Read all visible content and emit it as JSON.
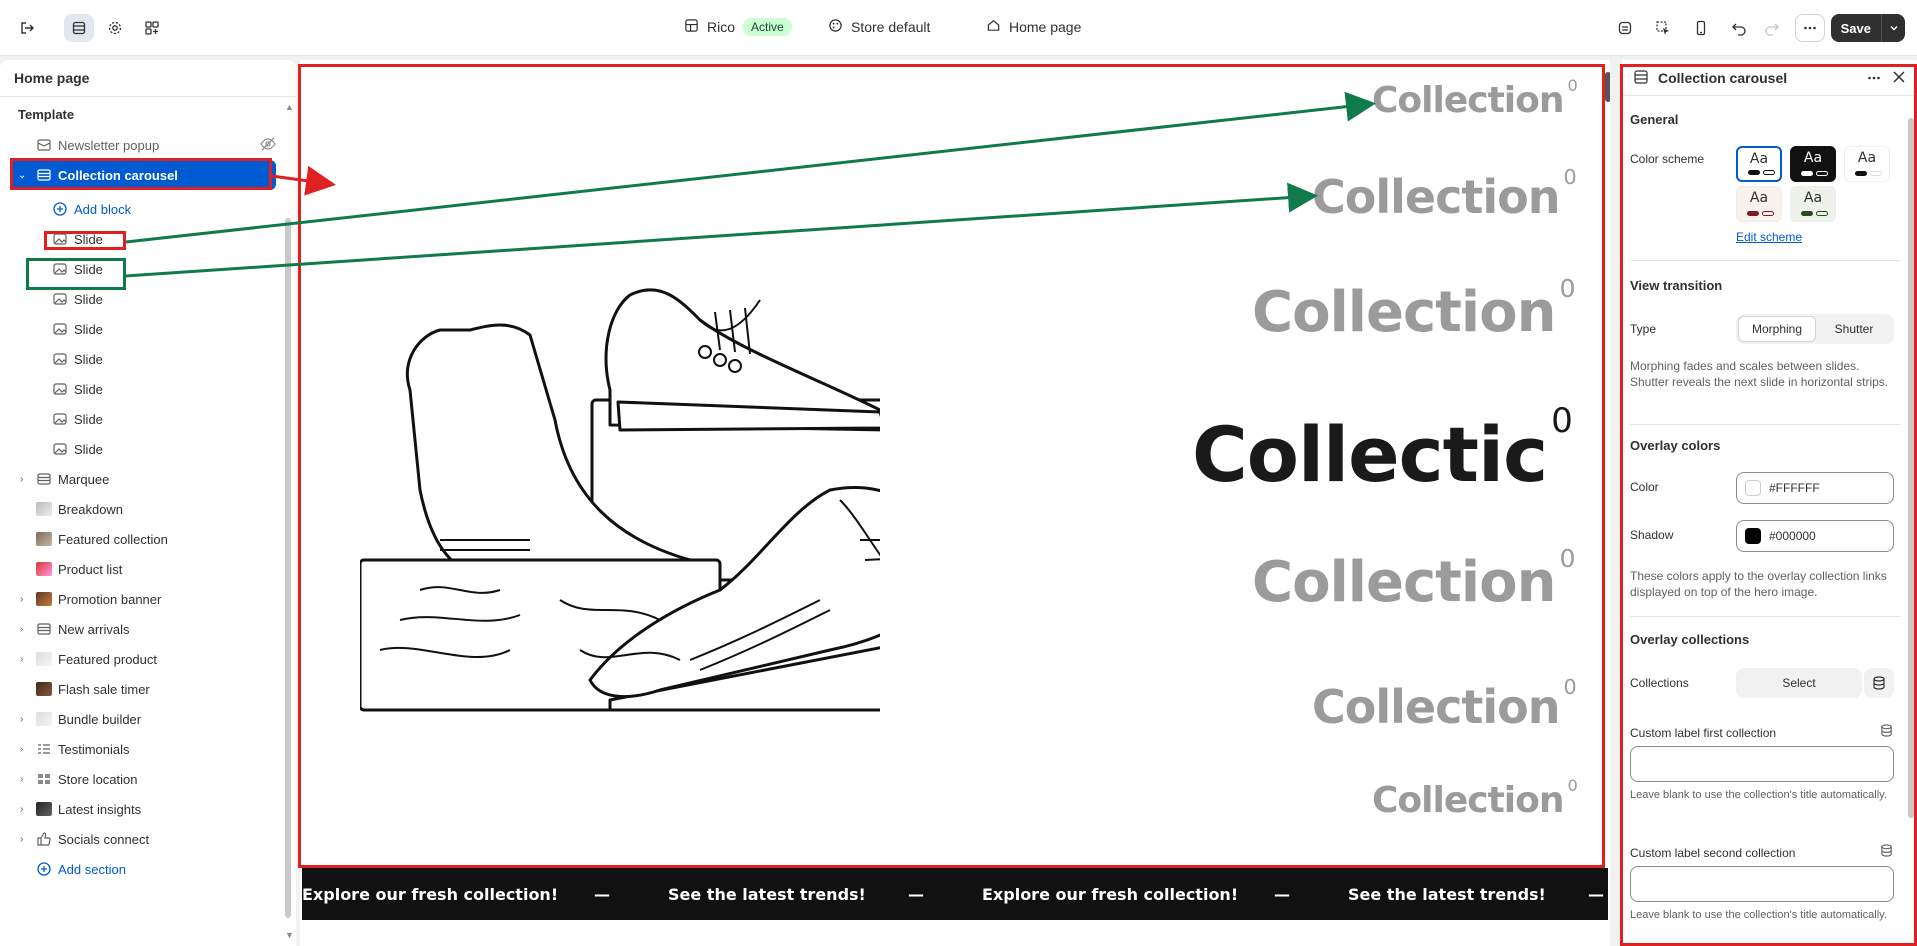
{
  "topbar": {
    "store_name": "Rico",
    "status_badge": "Active",
    "theme_label": "Store default",
    "page_label": "Home page",
    "save_label": "Save"
  },
  "left_panel": {
    "title": "Home page",
    "subheading": "Template",
    "items": [
      {
        "label": "Newsletter popup",
        "icon": "popup-icon"
      },
      {
        "label": "Collection carousel",
        "icon": "section-icon"
      },
      {
        "label": "Add block",
        "icon": "plus-circle-icon"
      },
      {
        "label": "Slide",
        "icon": "image-icon"
      },
      {
        "label": "Slide",
        "icon": "image-icon"
      },
      {
        "label": "Slide",
        "icon": "image-icon"
      },
      {
        "label": "Slide",
        "icon": "image-icon"
      },
      {
        "label": "Slide",
        "icon": "image-icon"
      },
      {
        "label": "Slide",
        "icon": "image-icon"
      },
      {
        "label": "Slide",
        "icon": "image-icon"
      },
      {
        "label": "Slide",
        "icon": "image-icon"
      },
      {
        "label": "Marquee",
        "icon": "section-icon"
      },
      {
        "label": "Breakdown",
        "icon": "thumbnail"
      },
      {
        "label": "Featured collection",
        "icon": "thumbnail"
      },
      {
        "label": "Product list",
        "icon": "thumbnail"
      },
      {
        "label": "Promotion banner",
        "icon": "thumbnail"
      },
      {
        "label": "New arrivals",
        "icon": "section-icon"
      },
      {
        "label": "Featured product",
        "icon": "thumbnail"
      },
      {
        "label": "Flash sale timer",
        "icon": "thumbnail"
      },
      {
        "label": "Bundle builder",
        "icon": "thumbnail"
      },
      {
        "label": "Testimonials",
        "icon": "list-icon"
      },
      {
        "label": "Store location",
        "icon": "grid-icon"
      },
      {
        "label": "Latest insights",
        "icon": "thumbnail"
      },
      {
        "label": "Socials connect",
        "icon": "thumbs-up-icon"
      },
      {
        "label": "Add section",
        "icon": "plus-circle-icon"
      }
    ]
  },
  "preview": {
    "collection_word": "Collection",
    "collection_active": "Collectic",
    "superscript": "0",
    "marquee": [
      "Explore our fresh collection!",
      "—",
      "See the latest trends!",
      "—",
      "Explore our fresh collection!",
      "—",
      "See the latest trends!",
      "—"
    ]
  },
  "right_panel": {
    "title": "Collection carousel",
    "general": "General",
    "color_scheme_label": "Color scheme",
    "swatch_text": "Aa",
    "edit_scheme": "Edit scheme",
    "view_transition": "View transition",
    "type_label": "Type",
    "type_options": [
      "Morphing",
      "Shutter"
    ],
    "type_help": "Morphing fades and scales between slides. Shutter reveals the next slide in horizontal strips.",
    "overlay_colors": "Overlay colors",
    "color_label": "Color",
    "color_value": "#FFFFFF",
    "shadow_label": "Shadow",
    "shadow_value": "#000000",
    "colors_help": "These colors apply to the overlay collection links displayed on top of the hero image.",
    "overlay_collections": "Overlay collections",
    "collections_label": "Collections",
    "select_label": "Select",
    "custom_first": "Custom label first collection",
    "custom_help": "Leave blank to use the collection's title automatically.",
    "custom_second": "Custom label second collection"
  },
  "colors": {
    "accent": "#005bd3",
    "annotation_red": "#e02020",
    "annotation_green": "#0f7a4a"
  }
}
